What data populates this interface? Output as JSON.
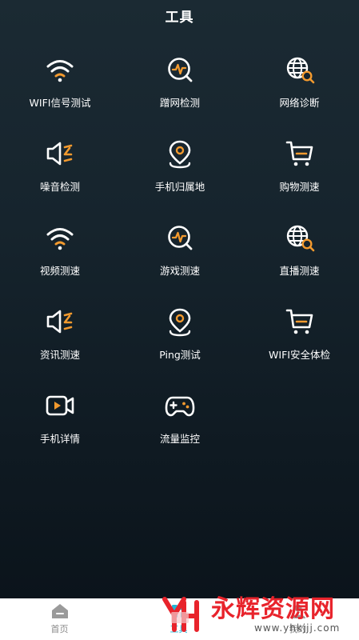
{
  "header": {
    "title": "工具"
  },
  "colors": {
    "accent": "#f39a2e",
    "icon_stroke": "#ffffff",
    "active_tab": "#22b6d6"
  },
  "tools": [
    {
      "label": "WIFI信号测试",
      "icon": "wifi-icon"
    },
    {
      "label": "蹭网检测",
      "icon": "chat-pulse-icon"
    },
    {
      "label": "网络诊断",
      "icon": "globe-search-icon"
    },
    {
      "label": "噪音检测",
      "icon": "speaker-icon"
    },
    {
      "label": "手机归属地",
      "icon": "location-pin-icon"
    },
    {
      "label": "购物测速",
      "icon": "shopping-cart-icon"
    },
    {
      "label": "视频测速",
      "icon": "wifi-icon"
    },
    {
      "label": "游戏测速",
      "icon": "chat-pulse-icon"
    },
    {
      "label": "直播测速",
      "icon": "globe-search-icon"
    },
    {
      "label": "资讯测速",
      "icon": "speaker-icon"
    },
    {
      "label": "Ping测试",
      "icon": "location-pin-icon"
    },
    {
      "label": "WIFI安全体检",
      "icon": "shopping-cart-icon"
    },
    {
      "label": "手机详情",
      "icon": "video-camera-icon"
    },
    {
      "label": "流量监控",
      "icon": "gamepad-icon"
    }
  ],
  "tabbar": {
    "tabs": [
      {
        "label": "首页",
        "icon": "home-icon"
      },
      {
        "label": "工具",
        "icon": "tools-icon"
      },
      {
        "label": "我的",
        "icon": "profile-icon"
      }
    ],
    "active_index": 1
  },
  "watermark": {
    "title": "永辉资源网",
    "url": "www.yhkjjj.com"
  }
}
